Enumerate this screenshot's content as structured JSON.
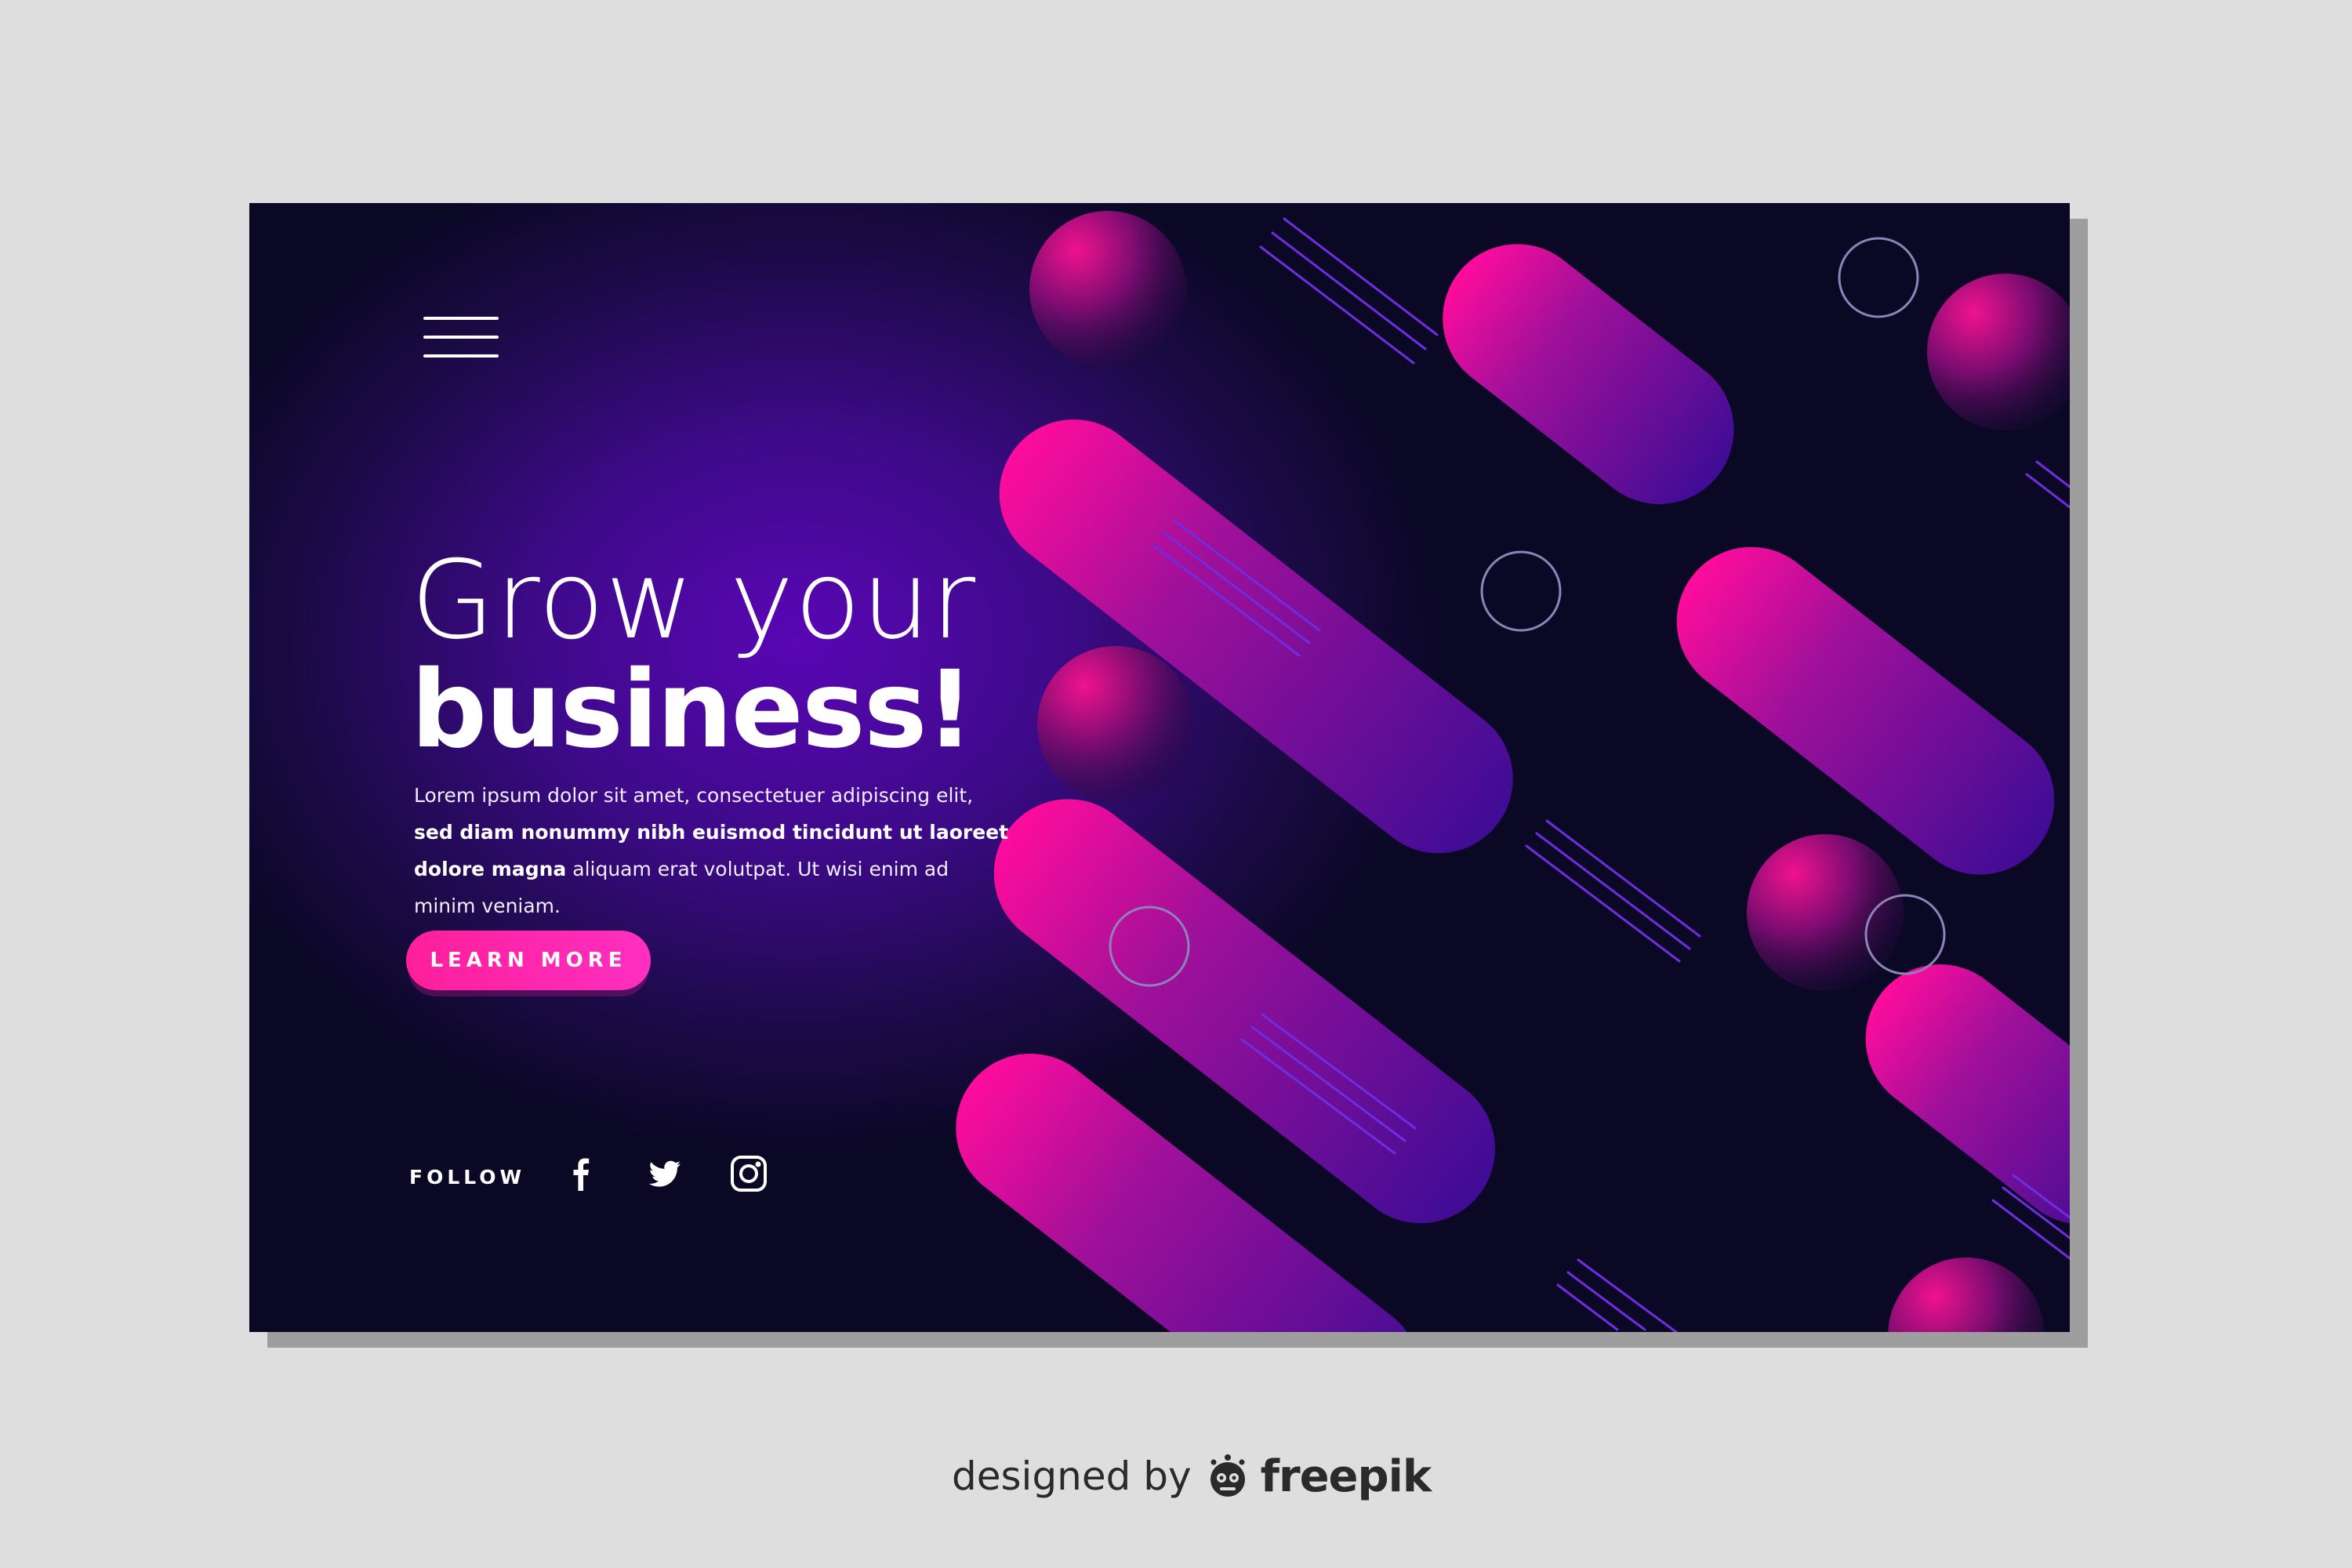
{
  "hero": {
    "title_line1": "Grow your",
    "title_line2": "business!",
    "body": {
      "p1": "Lorem ipsum dolor sit amet, consectetuer adipiscing elit, ",
      "p2": "sed diam nonummy nibh euismod tincidunt ut laoreet dolore magna",
      "p3": " aliquam erat volutpat. Ut wisi enim ad minim veniam."
    },
    "cta_label": "LEARN MORE"
  },
  "follow": {
    "label": "FOLLOW",
    "icons": [
      "facebook-icon",
      "twitter-icon",
      "instagram-icon"
    ]
  },
  "colors": {
    "background_dark": "#0b0826",
    "background_glow": "#5a06b4",
    "accent_pink": "#ff1f9b",
    "shape_pink": "#f0098f",
    "shape_purple": "#4a0d9a",
    "page_background": "#dedede"
  },
  "credit": {
    "designed_by": "designed by",
    "brand": "freepik"
  }
}
